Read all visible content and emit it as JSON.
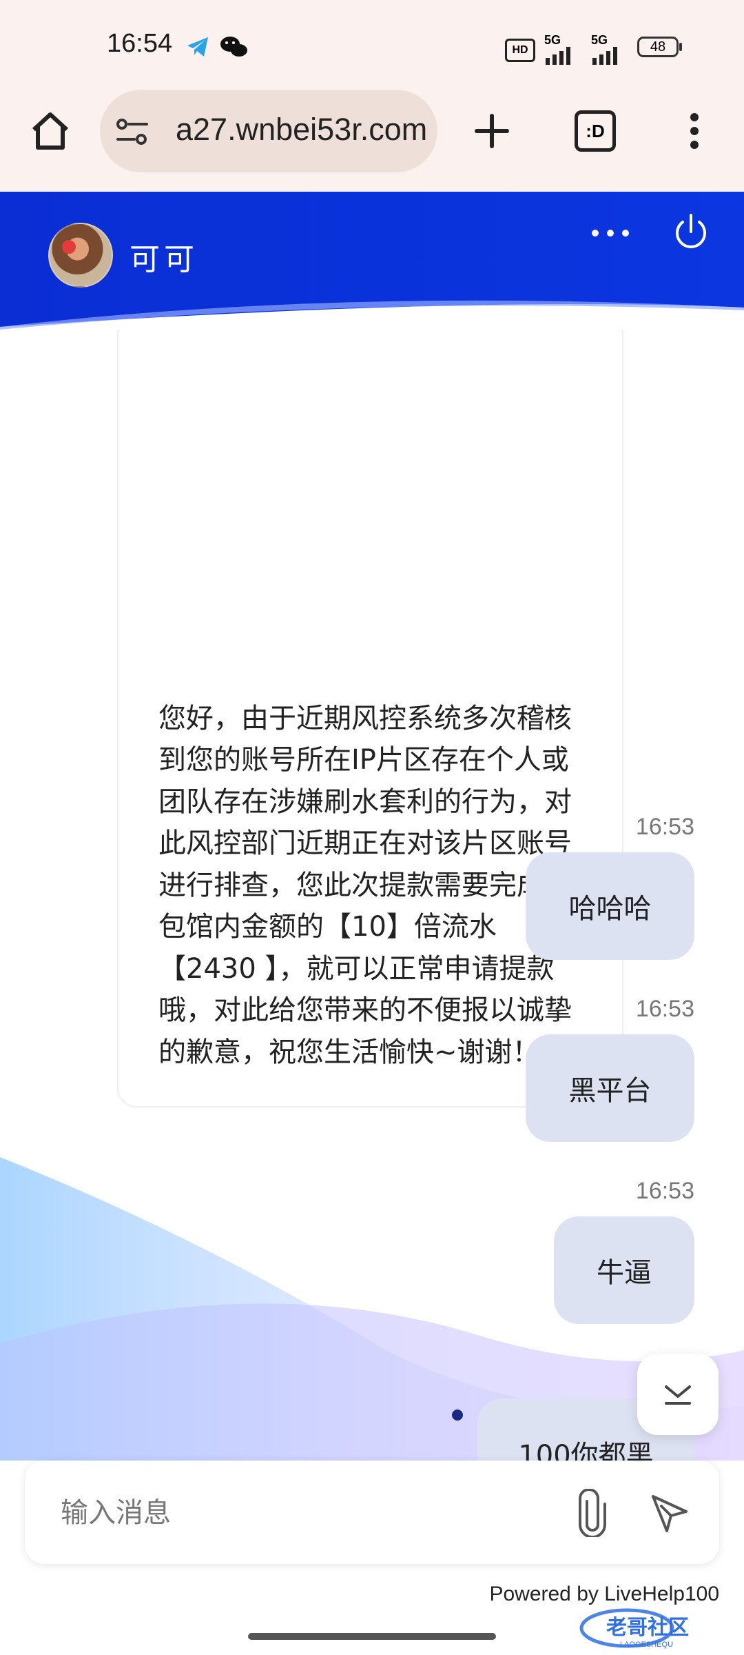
{
  "status_bar": {
    "time": "16:54",
    "network_1": "5G",
    "network_2": "5G",
    "hd_label": "HD",
    "battery": "48"
  },
  "browser": {
    "url": "a27.wnbei53r.com",
    "tab_count_label": ":D"
  },
  "chat_header": {
    "agent_name": "可可",
    "background_color": "#0a2ed4"
  },
  "messages": [
    {
      "direction": "in",
      "text": "您好，由于近期风控系统多次稽核到您的账号所在IP片区存在个人或团队存在涉嫌刷水套利的行为，对此风控部门近期正在对该片区账号进行排查，您此次提款需要完成钱包馆内金额的【10】倍流水【2430 】，就可以正常申请提款哦，对此给您带来的不便报以诚挚的歉意，祝您生活愉快~谢谢！"
    },
    {
      "direction": "out",
      "time": "16:53",
      "text": "哈哈哈"
    },
    {
      "direction": "out",
      "time": "16:53",
      "text": "黑平台"
    },
    {
      "direction": "out",
      "time": "16:53",
      "text": "牛逼"
    },
    {
      "direction": "out",
      "time": "",
      "text": "100你都黑"
    }
  ],
  "composer": {
    "placeholder": "输入消息"
  },
  "footer": {
    "powered_by": "Powered by LiveHelp100",
    "watermark": "老哥社区",
    "watermark_sub": "LAOGESHEQU"
  },
  "colors": {
    "header_blue": "#0a2ed4",
    "outgoing_bubble": "#dde2f2",
    "browser_bar": "#fbf1ee"
  }
}
